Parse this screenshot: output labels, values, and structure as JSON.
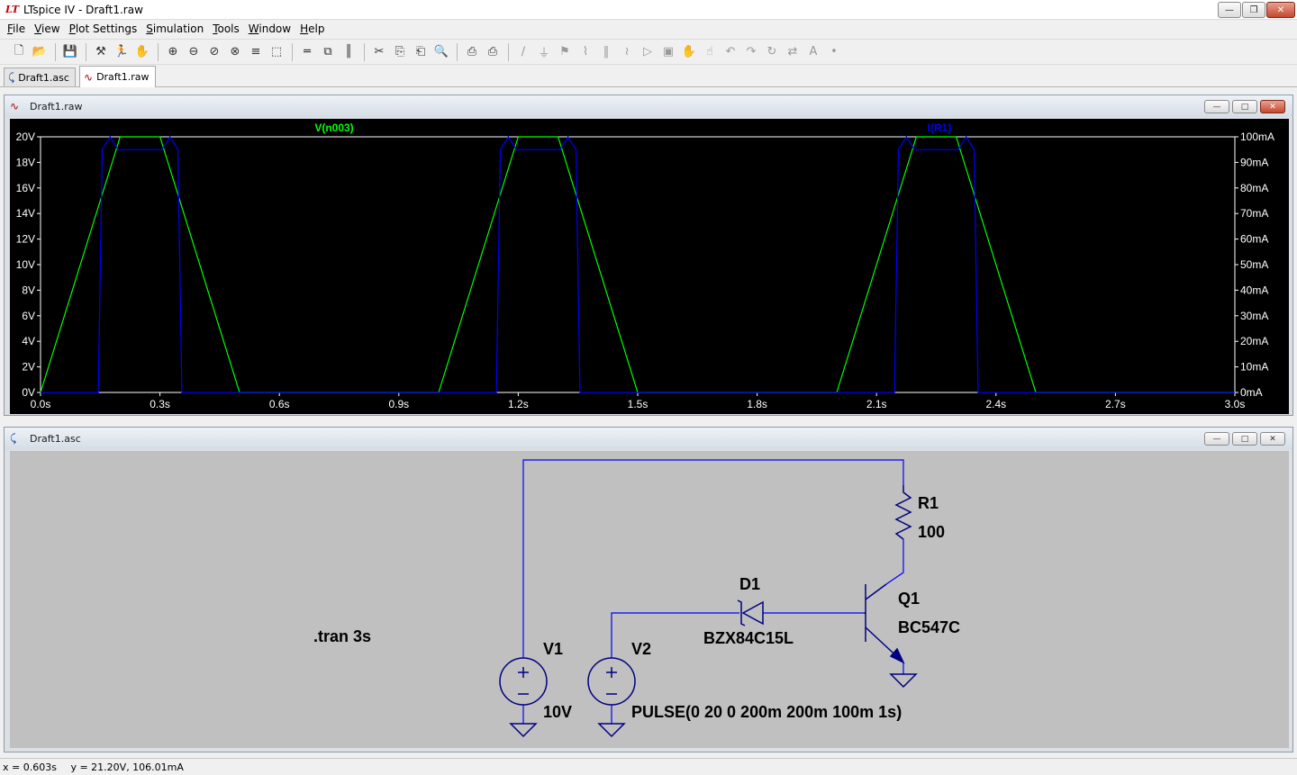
{
  "window": {
    "title": "LTspice IV - Draft1.raw"
  },
  "menu": [
    {
      "label": "File",
      "key": "F",
      "rest": "ile"
    },
    {
      "label": "View",
      "key": "V",
      "rest": "iew"
    },
    {
      "label": "Plot Settings",
      "key": "P",
      "rest": "lot Settings"
    },
    {
      "label": "Simulation",
      "key": "S",
      "rest": "imulation"
    },
    {
      "label": "Tools",
      "key": "T",
      "rest": "ools"
    },
    {
      "label": "Window",
      "key": "W",
      "rest": "indow"
    },
    {
      "label": "Help",
      "key": "H",
      "rest": "elp"
    }
  ],
  "toolbar_icons": [
    "new-schematic-icon",
    "open-icon",
    "save-icon",
    "control-panel-icon",
    "run-icon",
    "halt-icon",
    "zoom-in-icon",
    "zoom-out-icon",
    "zoom-fit-icon",
    "zoom-cancel-icon",
    "autorange-icon",
    "zoom-back-icon",
    "tile-horizontal-icon",
    "cascade-icon",
    "tile-vertical-icon",
    "cut-icon",
    "copy-icon",
    "paste-icon",
    "find-icon",
    "print-setup-icon",
    "print-icon",
    "wire-icon",
    "ground-icon",
    "label-icon",
    "resistor-icon",
    "capacitor-icon",
    "inductor-icon",
    "diode-icon",
    "component-icon",
    "move-icon",
    "drag-icon",
    "undo-icon",
    "redo-icon",
    "rotate-icon",
    "mirror-icon",
    "text-icon",
    "spice-directive-icon"
  ],
  "tabs": [
    {
      "label": "Draft1.asc",
      "icon": "schematic-icon",
      "active": false
    },
    {
      "label": "Draft1.raw",
      "icon": "waveform-icon",
      "active": true
    }
  ],
  "plot_window": {
    "title": "Draft1.raw",
    "background": "#000000",
    "trace_labels": [
      {
        "text": "V(n003)",
        "color": "#00ff00"
      },
      {
        "text": "I(R1)",
        "color": "#0000ff"
      }
    ]
  },
  "chart_data": {
    "type": "line",
    "title": "",
    "xlabel": "",
    "ylabel": "",
    "xlim": [
      0,
      3.0
    ],
    "ylim_left": [
      0,
      20
    ],
    "ylim_right": [
      0,
      100
    ],
    "grid": false,
    "x_ticks": [
      "0.0s",
      "0.3s",
      "0.6s",
      "0.9s",
      "1.2s",
      "1.5s",
      "1.8s",
      "2.1s",
      "2.4s",
      "2.7s",
      "3.0s"
    ],
    "y_ticks_left": [
      "0V",
      "2V",
      "4V",
      "6V",
      "8V",
      "10V",
      "12V",
      "14V",
      "16V",
      "18V",
      "20V"
    ],
    "y_ticks_right": [
      "0mA",
      "10mA",
      "20mA",
      "30mA",
      "40mA",
      "50mA",
      "60mA",
      "70mA",
      "80mA",
      "90mA",
      "100mA"
    ],
    "series": [
      {
        "name": "V(n003)",
        "axis": "left",
        "color": "#00ff00",
        "points": [
          [
            0,
            0
          ],
          [
            0.2,
            20
          ],
          [
            0.3,
            20
          ],
          [
            0.5,
            0
          ],
          [
            1.0,
            0
          ],
          [
            1.2,
            20
          ],
          [
            1.3,
            20
          ],
          [
            1.5,
            0
          ],
          [
            2.0,
            0
          ],
          [
            2.2,
            20
          ],
          [
            2.3,
            20
          ],
          [
            2.5,
            0
          ],
          [
            3.0,
            0
          ]
        ]
      },
      {
        "name": "I(R1)",
        "axis": "right",
        "color": "#0000ff",
        "points": [
          [
            0,
            0
          ],
          [
            0.145,
            0
          ],
          [
            0.155,
            95
          ],
          [
            0.175,
            100
          ],
          [
            0.195,
            95
          ],
          [
            0.24,
            95
          ],
          [
            0.28,
            95
          ],
          [
            0.305,
            95
          ],
          [
            0.325,
            100
          ],
          [
            0.345,
            95
          ],
          [
            0.355,
            0
          ],
          [
            1.145,
            0
          ],
          [
            1.155,
            95
          ],
          [
            1.175,
            100
          ],
          [
            1.195,
            95
          ],
          [
            1.305,
            95
          ],
          [
            1.325,
            100
          ],
          [
            1.345,
            95
          ],
          [
            1.355,
            0
          ],
          [
            2.145,
            0
          ],
          [
            2.155,
            95
          ],
          [
            2.175,
            100
          ],
          [
            2.195,
            95
          ],
          [
            2.305,
            95
          ],
          [
            2.325,
            100
          ],
          [
            2.345,
            95
          ],
          [
            2.355,
            0
          ],
          [
            3.0,
            0
          ]
        ]
      }
    ]
  },
  "schematic_window": {
    "title": "Draft1.asc",
    "background": "#c0c0c0",
    "wire_color": "#0000ff",
    "directive": ".tran 3s",
    "components": [
      {
        "ref": "R1",
        "value": "100"
      },
      {
        "ref": "D1",
        "value": "BZX84C15L"
      },
      {
        "ref": "Q1",
        "value": "BC547C"
      },
      {
        "ref": "V1",
        "value": "10V"
      },
      {
        "ref": "V2",
        "value": "PULSE(0 20 0 200m 200m 100m 1s)"
      }
    ]
  },
  "status": {
    "x": "x = 0.603s",
    "y": "y = 21.20V, 106.01mA"
  }
}
